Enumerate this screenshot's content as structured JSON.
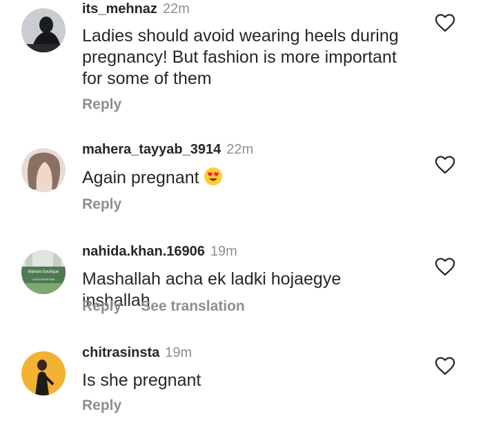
{
  "comments": [
    {
      "username": "its_mehnaz",
      "time": "22m",
      "text": "Ladies should avoid wearing heels during pregnancy! But fashion is more important for some of them",
      "reply_label": "Reply"
    },
    {
      "username": "mahera_tayyab_3914",
      "time": "22m",
      "text": "Again pregnant",
      "emoji": "heart-eyes-emoji",
      "reply_label": "Reply"
    },
    {
      "username": "nahida.khan.16906",
      "time": "19m",
      "text": "Mashallah acha ek ladki hojaegye inshallah",
      "reply_label": "Reply",
      "translation_label": "See translation",
      "avatar_text": {
        "shop_name": "Mariam boutique",
        "tagline": "OUR EXPERTISE"
      }
    },
    {
      "username": "chitrasinsta",
      "time": "19m",
      "text": "Is she pregnant",
      "reply_label": "Reply"
    }
  ],
  "icons": {
    "like": "heart-outline-icon"
  },
  "colors": {
    "text_primary": "#262626",
    "text_secondary": "#8e8e8e",
    "background": "#ffffff"
  }
}
